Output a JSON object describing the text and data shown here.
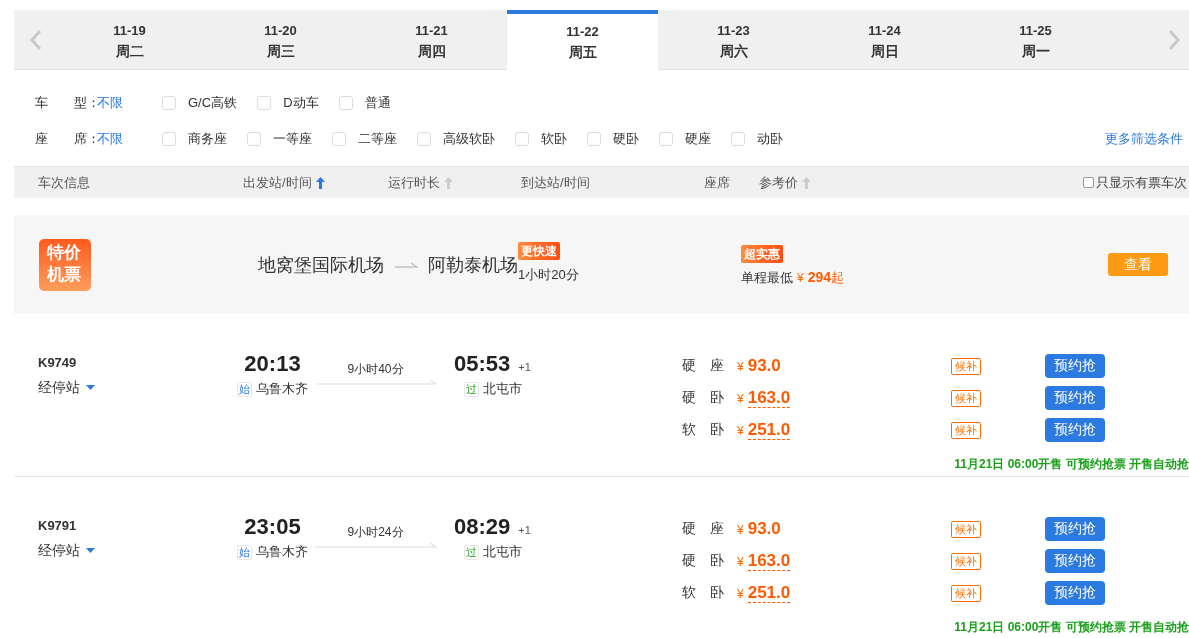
{
  "date_tabs": [
    {
      "date": "11-19",
      "weekday": "周二",
      "selected": false
    },
    {
      "date": "11-20",
      "weekday": "周三",
      "selected": false
    },
    {
      "date": "11-21",
      "weekday": "周四",
      "selected": false
    },
    {
      "date": "11-22",
      "weekday": "周五",
      "selected": true
    },
    {
      "date": "11-23",
      "weekday": "周六",
      "selected": false
    },
    {
      "date": "11-24",
      "weekday": "周日",
      "selected": false
    },
    {
      "date": "11-25",
      "weekday": "周一",
      "selected": false
    }
  ],
  "filters": [
    {
      "label": "车　　型：",
      "value": "不限",
      "options": [
        {
          "label": "G/C高铁",
          "checked": false
        },
        {
          "label": "D动车",
          "checked": false
        },
        {
          "label": "普通",
          "checked": false
        }
      ]
    },
    {
      "label": "座　　席：",
      "value": "不限",
      "options": [
        {
          "label": "商务座",
          "checked": false
        },
        {
          "label": "一等座",
          "checked": false
        },
        {
          "label": "二等座",
          "checked": false
        },
        {
          "label": "高级软卧",
          "checked": false
        },
        {
          "label": "软卧",
          "checked": false
        },
        {
          "label": "硬卧",
          "checked": false
        },
        {
          "label": "硬座",
          "checked": false
        },
        {
          "label": "动卧",
          "checked": false
        }
      ]
    }
  ],
  "more_filters": "更多筛选条件",
  "columns": [
    {
      "label": "车次信息"
    },
    {
      "label": "出发站/时间",
      "sorted": true
    },
    {
      "label": "运行时长",
      "sorted": false
    },
    {
      "label": "到达站/时间"
    },
    {
      "label": "座席"
    },
    {
      "label": "参考价",
      "sorted": false
    }
  ],
  "only_available": {
    "label": "只显示有票车次",
    "checked": false
  },
  "flight_promo": {
    "badge": "特价机票",
    "from": "地窝堡国际机场",
    "to": "阿勒泰机场",
    "speed_tag": "更快速",
    "duration": "1小时20分",
    "price_tag": "超实惠",
    "price_label": "单程最低",
    "currency": "¥",
    "price": "294",
    "price_suffix": "起",
    "button": "查看"
  },
  "trains": [
    {
      "number": "K9749",
      "stops": "经停站",
      "depart_time": "20:13",
      "depart_station": {
        "kind": "start",
        "mark": "始",
        "name": "乌鲁木齐"
      },
      "duration": "9小时40分",
      "arrive_time": "05:53",
      "day_offset": "+1",
      "arrive_station": {
        "kind": "pass",
        "mark": "过",
        "name": "北屯市"
      },
      "seats": [
        {
          "name": "硬　座",
          "currency": "¥",
          "price": "93.0",
          "underlined": false,
          "waitlist": "候补",
          "button": "预约抢"
        },
        {
          "name": "硬　卧",
          "currency": "¥",
          "price": "163.0",
          "underlined": true,
          "waitlist": "候补",
          "button": "预约抢"
        },
        {
          "name": "软　卧",
          "currency": "¥",
          "price": "251.0",
          "underlined": true,
          "waitlist": "候补",
          "button": "预约抢"
        }
      ],
      "note": "11月21日 06:00开售 可预约抢票 开售自动抢"
    },
    {
      "number": "K9791",
      "stops": "经停站",
      "depart_time": "23:05",
      "depart_station": {
        "kind": "start",
        "mark": "始",
        "name": "乌鲁木齐"
      },
      "duration": "9小时24分",
      "arrive_time": "08:29",
      "day_offset": "+1",
      "arrive_station": {
        "kind": "pass",
        "mark": "过",
        "name": "北屯市"
      },
      "seats": [
        {
          "name": "硬　座",
          "currency": "¥",
          "price": "93.0",
          "underlined": false,
          "waitlist": "候补",
          "button": "预约抢"
        },
        {
          "name": "硬　卧",
          "currency": "¥",
          "price": "163.0",
          "underlined": true,
          "waitlist": "候补",
          "button": "预约抢"
        },
        {
          "name": "软　卧",
          "currency": "¥",
          "price": "251.0",
          "underlined": true,
          "waitlist": "候补",
          "button": "预约抢"
        }
      ],
      "note": "11月21日 06:00开售 可预约抢票 开售自动抢"
    }
  ]
}
